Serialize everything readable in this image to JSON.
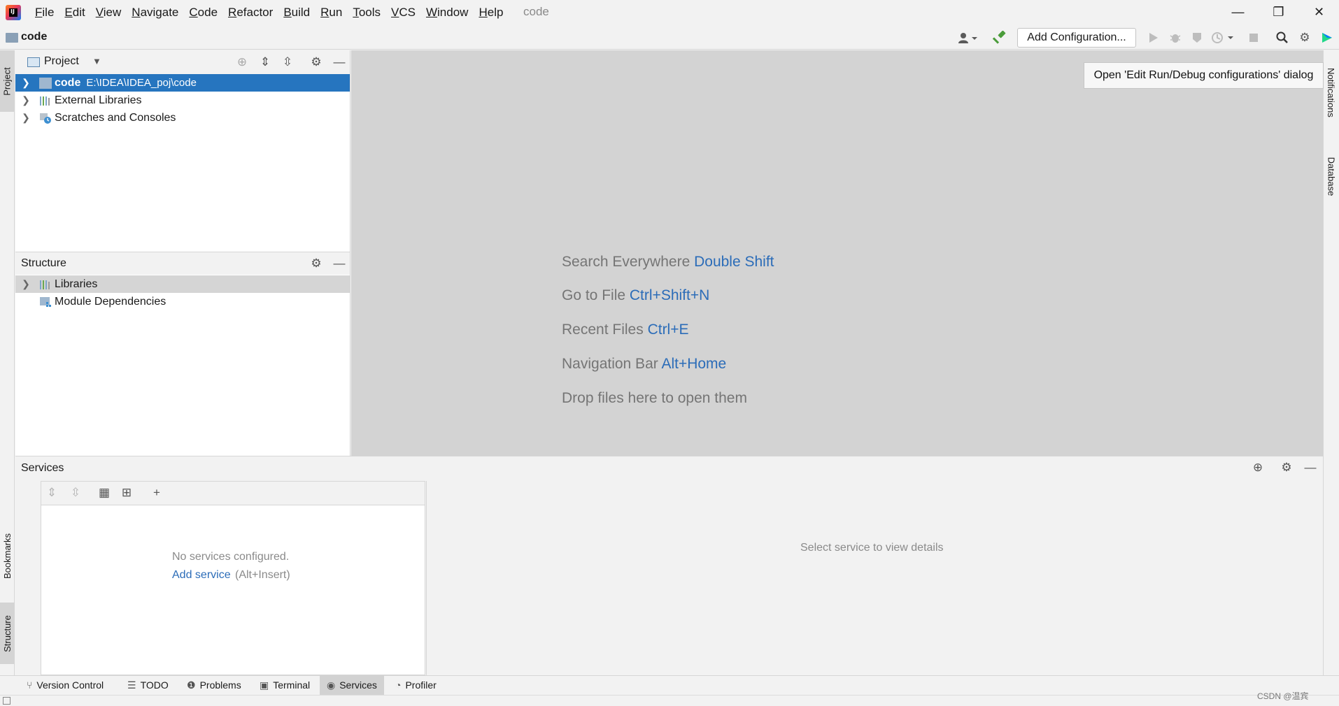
{
  "app": {
    "logo_letters": "IJ",
    "window_title": "code",
    "menu": [
      "File",
      "Edit",
      "View",
      "Navigate",
      "Code",
      "Refactor",
      "Build",
      "Run",
      "Tools",
      "VCS",
      "Window",
      "Help"
    ],
    "window_controls": {
      "minimize": "—",
      "restore": "❐",
      "close": "✕"
    }
  },
  "navbar": {
    "breadcrumb": "code",
    "add_configuration_label": "Add Configuration...",
    "tooltip": "Open 'Edit Run/Debug configurations' dialog"
  },
  "left_stripe": {
    "project_tab": "Project",
    "bookmarks_tab": "Bookmarks",
    "structure_tab": "Structure"
  },
  "right_stripe": {
    "notifications_tab": "Notifications",
    "database_tab": "Database"
  },
  "project_panel": {
    "title": "Project",
    "items": [
      {
        "name": "code",
        "path": "E:\\IDEA\\IDEA_poj\\code"
      },
      {
        "name": "External Libraries"
      },
      {
        "name": "Scratches and Consoles"
      }
    ]
  },
  "structure_panel": {
    "title": "Structure",
    "items": [
      {
        "name": "Libraries"
      },
      {
        "name": "Module Dependencies"
      }
    ]
  },
  "editor": {
    "hints": [
      {
        "text": "Search Everywhere",
        "key": "Double Shift"
      },
      {
        "text": "Go to File",
        "key": "Ctrl+Shift+N"
      },
      {
        "text": "Recent Files",
        "key": "Ctrl+E"
      },
      {
        "text": "Navigation Bar",
        "key": "Alt+Home"
      },
      {
        "text": "Drop files here to open them",
        "key": ""
      }
    ]
  },
  "services": {
    "title": "Services",
    "empty_text": "No services configured.",
    "add_service_link": "Add service",
    "add_service_shortcut": "(Alt+Insert)",
    "detail_placeholder": "Select service to view details"
  },
  "bottom_tabs": [
    {
      "label": "Version Control",
      "icon": "branch-icon"
    },
    {
      "label": "TODO",
      "icon": "list-icon"
    },
    {
      "label": "Problems",
      "icon": "warning-circle-icon"
    },
    {
      "label": "Terminal",
      "icon": "terminal-icon"
    },
    {
      "label": "Services",
      "icon": "services-icon"
    },
    {
      "label": "Profiler",
      "icon": "profiler-icon"
    }
  ],
  "watermark": "CSDN @温宾",
  "colors": {
    "selection": "#2675bf",
    "link": "#2b6cb8",
    "editor_bg": "#d3d3d3"
  }
}
